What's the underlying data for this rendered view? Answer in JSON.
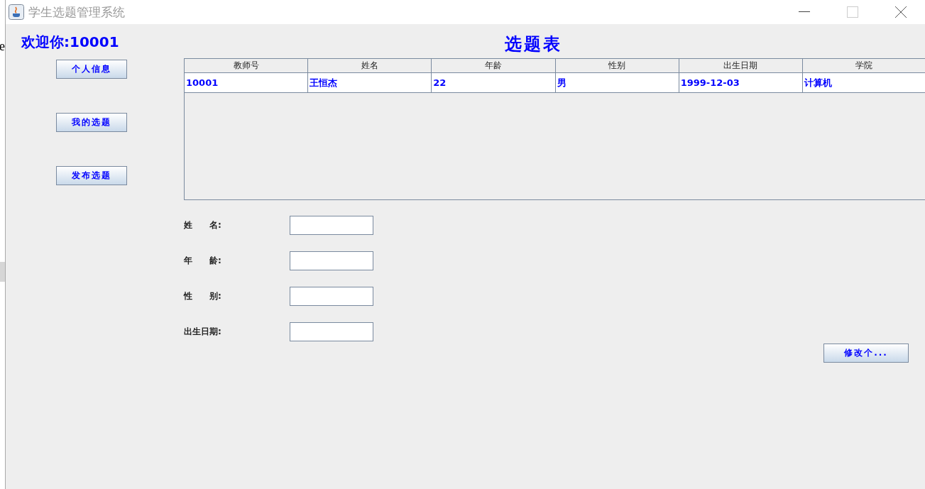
{
  "background_fragment": "e",
  "window": {
    "title": "学生选题管理系统"
  },
  "welcome": "欢迎你:10001",
  "nav_buttons": [
    "个人信息",
    "我的选题",
    "发布选题"
  ],
  "table_title": "选题表",
  "table": {
    "columns": [
      "教师号",
      "姓名",
      "年龄",
      "性别",
      "出生日期",
      "学院"
    ],
    "rows": [
      [
        "10001",
        "王恒杰",
        "22",
        "男",
        "1999-12-03",
        "计算机"
      ]
    ]
  },
  "form": [
    {
      "label": "姓　　名:"
    },
    {
      "label": "年　　龄:"
    },
    {
      "label": "性　　别:"
    },
    {
      "label": "出生日期:"
    }
  ],
  "submit_button": "修改个..."
}
